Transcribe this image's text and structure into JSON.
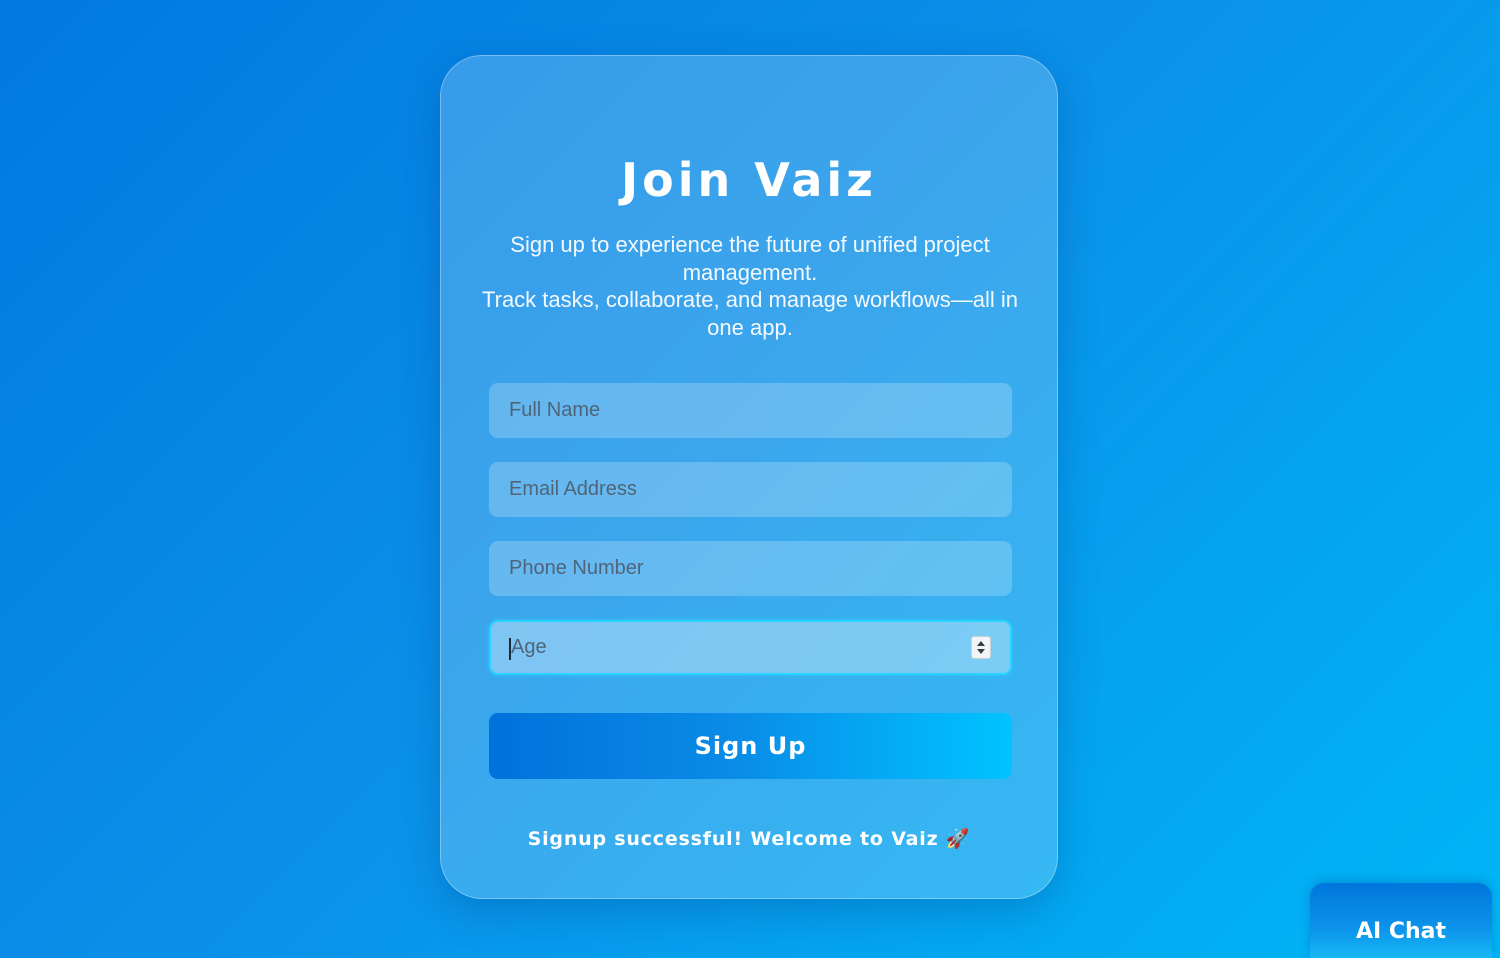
{
  "signup": {
    "title": "Join Vaiz",
    "subtitle_line1": "Sign up to experience the future of unified project management.",
    "subtitle_line2": "Track tasks, collaborate, and manage workflows—all in one app.",
    "fields": {
      "full_name": {
        "placeholder": "Full Name",
        "value": ""
      },
      "email": {
        "placeholder": "Email Address",
        "value": ""
      },
      "phone": {
        "placeholder": "Phone Number",
        "value": ""
      },
      "age": {
        "placeholder": "Age",
        "value": ""
      }
    },
    "submit_label": "Sign Up",
    "success_message": "Signup successful! Welcome to Vaiz 🚀"
  },
  "ai_chat": {
    "label": "AI Chat"
  },
  "icons": {
    "age_spinner": "spinner-arrows-icon"
  },
  "colors": {
    "background_start": "#0079e0",
    "background_end": "#00b6f7",
    "focus_border": "#2ad2ff",
    "button_start": "#0072db",
    "button_end": "#00c3ff"
  }
}
